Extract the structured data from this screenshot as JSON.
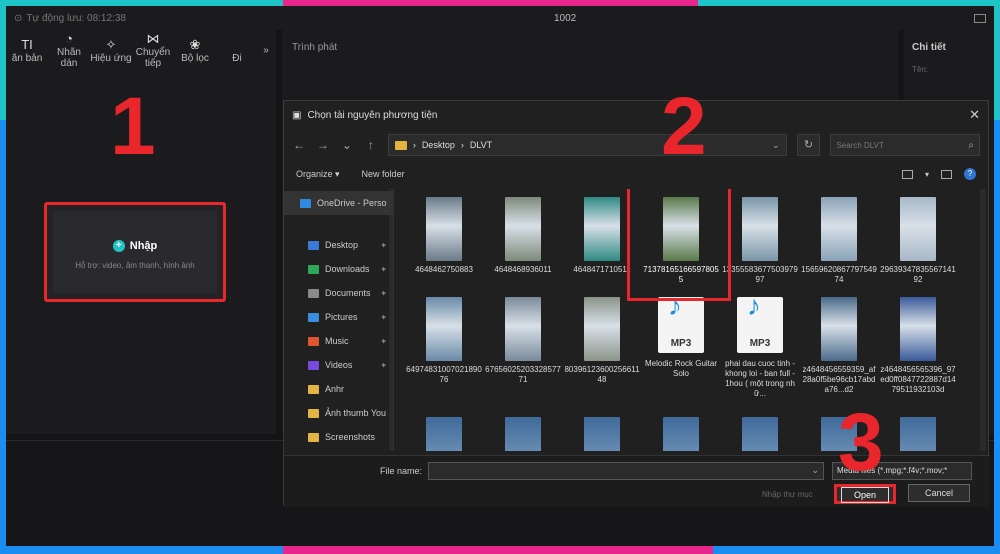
{
  "titlebar": {
    "autosave": "Tự động lưu: 08:12:38",
    "project": "1002"
  },
  "toolbar": {
    "items": [
      {
        "label": "ăn bản",
        "icon": "TI"
      },
      {
        "label": "Nhãn dán",
        "icon": "◔"
      },
      {
        "label": "Hiệu ứng",
        "icon": "✧"
      },
      {
        "label": "Chuyển tiếp",
        "icon": "⋈"
      },
      {
        "label": "Bộ lọc",
        "icon": "❀"
      },
      {
        "label": "Đi",
        "icon": ""
      }
    ],
    "more": "»"
  },
  "import": {
    "label": "Nhập",
    "support": "Hỗ trợ: video, âm thanh, hình ảnh"
  },
  "player": {
    "title": "Trình phát"
  },
  "details": {
    "title": "Chi tiết",
    "sub": "Tên:"
  },
  "annotations": {
    "n1": "1",
    "n2": "2",
    "n3": "3"
  },
  "dialog": {
    "title": "Chọn tài nguyên phương tiện",
    "address": [
      "Desktop",
      "DLVT"
    ],
    "sep": "›",
    "search_placeholder": "Search DLVT",
    "organize": "Organize ▾",
    "new_folder": "New folder",
    "nav": [
      {
        "label": "OneDrive - Perso",
        "color": "#2f8be0"
      },
      {
        "label": "Desktop",
        "color": "#3a7bd5",
        "pin": true
      },
      {
        "label": "Downloads",
        "color": "#2fa65a",
        "pin": true
      },
      {
        "label": "Documents",
        "color": "#8a8a8a",
        "pin": true
      },
      {
        "label": "Pictures",
        "color": "#3a8ee0",
        "pin": true
      },
      {
        "label": "Music",
        "color": "#e0552f",
        "pin": true
      },
      {
        "label": "Videos",
        "color": "#7a4ae0",
        "pin": true
      },
      {
        "label": "Anhr",
        "color": "#e1b53f"
      },
      {
        "label": "Ảnh thumb You",
        "color": "#e1b53f"
      },
      {
        "label": "Screenshots",
        "color": "#e1b53f"
      }
    ],
    "files": [
      {
        "name": "4648462750883",
        "color": "#6b7a88"
      },
      {
        "name": "4648468936011",
        "color": "#7d8a7a"
      },
      {
        "name": "4648471710511",
        "color": "#2f8a84"
      },
      {
        "name": "713781651665978055",
        "color": "#5a7a4a",
        "selected": true
      },
      {
        "name": "1335558367750397997",
        "color": "#7a96a8"
      },
      {
        "name": "1565962086779754974",
        "color": "#8aa2b8"
      },
      {
        "name": "2963934783556714192",
        "color": "#a8b8c8"
      },
      {
        "name": "6497483100702189076",
        "color": "#6a8aa8"
      },
      {
        "name": "6765602520332857771",
        "color": "#7a8a9a"
      },
      {
        "name": "8039612360025661148",
        "color": "#8a9488"
      },
      {
        "name": "Melodic Rock Guitar Solo",
        "mp3": true
      },
      {
        "name": "phai dau cuoc tinh - khong loi - ban full - 1hou ( một trong nhữ...",
        "mp3": true
      },
      {
        "name": "z4648456559359_af28a0f5be96cb17abda76...d2",
        "color": "#4a6a8a"
      },
      {
        "name": "z4648456565396_97ed0ff0847722887d1479511932103d",
        "color": "#3a5a9a"
      }
    ],
    "file_name_label": "File name:",
    "file_name_value": "",
    "filter": "Media files (*.mpg;*.f4v;*.mov;*",
    "import_mode": "Nhập thư mục",
    "open": "Open",
    "cancel": "Cancel"
  }
}
